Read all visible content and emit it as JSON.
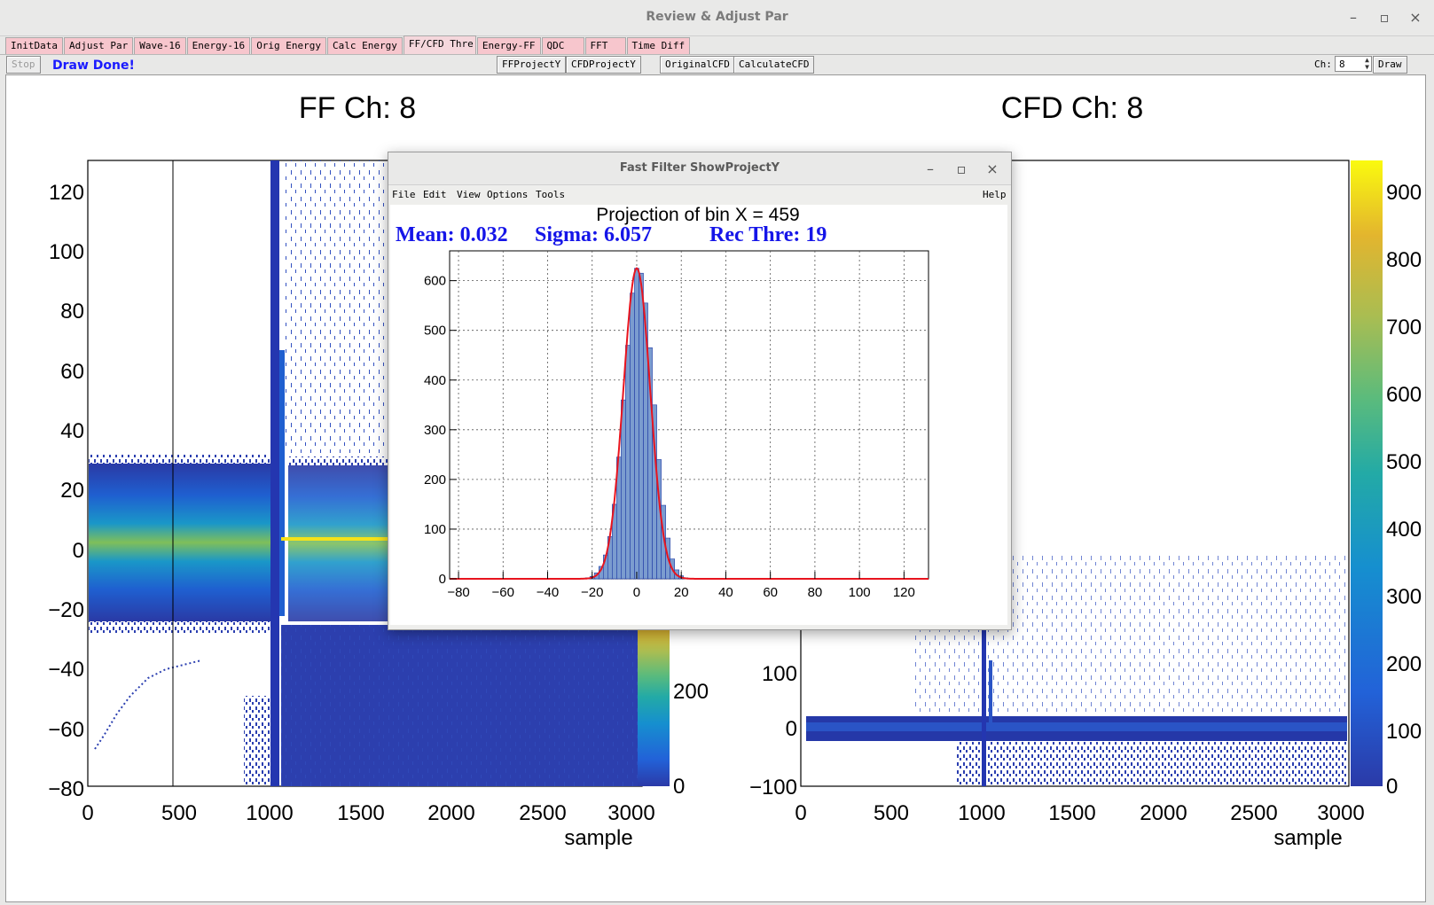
{
  "window": {
    "title": "Review & Adjust Par",
    "minimize": "–",
    "maximize": "▫",
    "close": "×"
  },
  "tabs": [
    "InitData",
    "Adjust Par",
    "Wave-16",
    "Energy-16",
    "Orig Energy",
    "Calc Energy",
    "FF/CFD Thre",
    "Energy-FF",
    "QDC",
    "FFT",
    "Time Diff"
  ],
  "active_tab": "FF/CFD Thre",
  "toolbar": {
    "stop": "Stop",
    "status": "Draw Done!",
    "ff_project": "FFProjectY",
    "cfd_project": "CFDProjectY",
    "original_cfd": "OriginalCFD",
    "calculate_cfd": "CalculateCFD",
    "ch_label": "Ch:",
    "ch_value": "8",
    "draw": "Draw"
  },
  "left_plot": {
    "title": "FF  Ch: 8",
    "xlabel": "sample",
    "xticks": [
      "0",
      "500",
      "1000",
      "1500",
      "2000",
      "2500",
      "3000"
    ],
    "yticks": [
      "120",
      "100",
      "80",
      "60",
      "40",
      "20",
      "0",
      "−20",
      "−40",
      "−60",
      "−80"
    ],
    "zticks": [
      "200",
      "0"
    ]
  },
  "right_plot": {
    "title": "CFD  Ch: 8",
    "xlabel": "sample",
    "xticks": [
      "0",
      "500",
      "1000",
      "1500",
      "2000",
      "2500",
      "3000"
    ],
    "yticks": [
      "100",
      "0",
      "−100"
    ],
    "zticks": [
      "900",
      "800",
      "700",
      "600",
      "500",
      "400",
      "300",
      "200",
      "100",
      "0"
    ]
  },
  "dialog": {
    "title": "Fast Filter ShowProjectY",
    "minimize": "–",
    "maximize": "▫",
    "close": "×",
    "menu": [
      "File",
      "Edit",
      "View",
      "Options",
      "Tools"
    ],
    "help": "Help",
    "plot_title": "Projection of bin X = 459",
    "stats": {
      "mean": "Mean: 0.032",
      "sigma": "Sigma: 6.057",
      "rec": "Rec Thre: 19"
    }
  },
  "chart_data": {
    "type": "bar",
    "title": "Projection of bin X = 459",
    "xlim": [
      -84,
      131
    ],
    "ylim": [
      0,
      660
    ],
    "xticks": [
      -80,
      -60,
      -40,
      -20,
      0,
      20,
      40,
      60,
      80,
      100,
      120
    ],
    "yticks": [
      0,
      100,
      200,
      300,
      400,
      500,
      600
    ],
    "grid": true,
    "fit": {
      "type": "gaussian",
      "mean": 0.032,
      "sigma": 6.057,
      "amplitude": 625,
      "color": "#e8141e"
    },
    "hist_color": "#7b9ccf",
    "hist_edge": "#1f3aa5",
    "x": [
      -22,
      -20,
      -18,
      -16,
      -14,
      -12,
      -10,
      -8,
      -6,
      -4,
      -2,
      0,
      2,
      4,
      6,
      8,
      10,
      12,
      14,
      16,
      18,
      20,
      22
    ],
    "values": [
      2,
      5,
      12,
      25,
      48,
      85,
      150,
      245,
      360,
      470,
      575,
      625,
      615,
      555,
      465,
      350,
      240,
      148,
      82,
      40,
      18,
      6,
      2
    ]
  }
}
